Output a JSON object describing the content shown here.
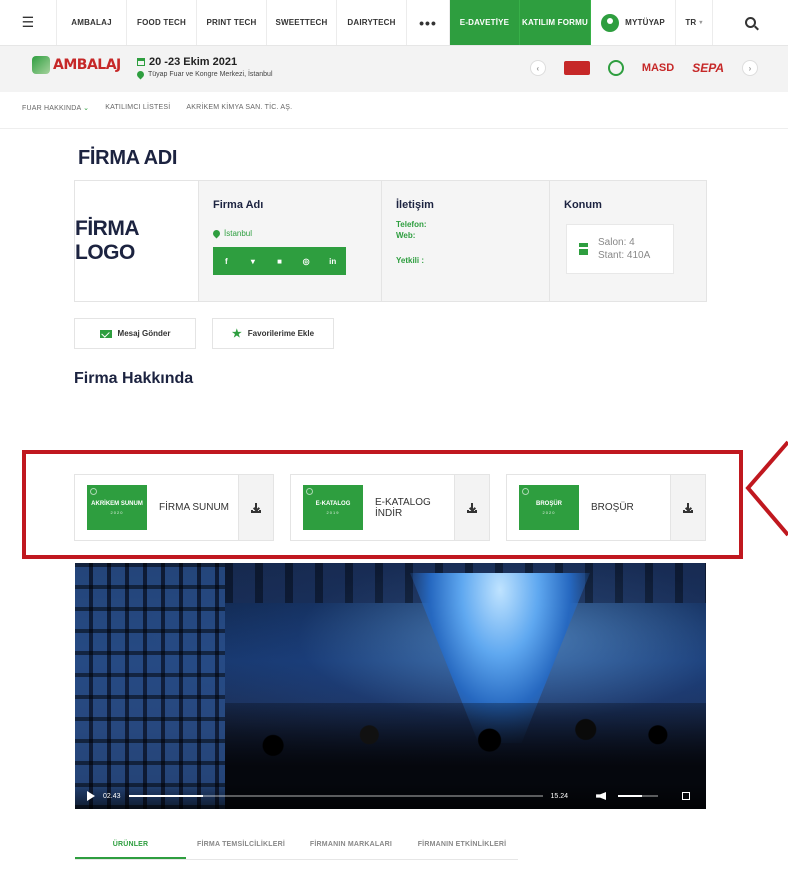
{
  "nav": {
    "menu_icon": "hamburger-icon",
    "items": [
      "AMBALAJ",
      "FOOD TECH",
      "PRINT TECH",
      "SWEETTECH",
      "DAIRYTECH"
    ],
    "more": "•••",
    "e_invite": "E-DAVETİYE",
    "participation_form": "KATILIM FORMU",
    "my_account": "MYTÜYAP",
    "language": "TR",
    "search_icon": "search-icon",
    "accent": "#2e9e3f"
  },
  "event": {
    "logo_text": "AMBALAJ",
    "date": "20 -23 Ekim 2021",
    "venue": "Tüyap Fuar ve Kongre Merkezi, İstanbul"
  },
  "sponsors": [
    "MASD",
    "SEPA"
  ],
  "breadcrumb": [
    "FUAR HAKKINDA",
    "KATILIMCI LİSTESİ",
    "AKRİKEM KİMYA SAN. TİC. AŞ."
  ],
  "page_title": "FİRMA ADI",
  "company": {
    "logo_placeholder": "FİRMA LOGO",
    "name_heading": "Firma Adı",
    "city": "İstanbul",
    "social": [
      "f",
      "t",
      "y",
      "ig",
      "in"
    ],
    "contact_heading": "İletişim",
    "phone_label": "Telefon:",
    "web_label": "Web:",
    "manager_label": "Yetkili :",
    "location_heading": "Konum",
    "hall": "Salon: 4",
    "stand": "Stant: 410A"
  },
  "actions": {
    "send_message": "Mesaj Gönder",
    "add_favorite": "Favorilerime Ekle"
  },
  "about_title": "Firma Hakkında",
  "documents": [
    {
      "thumb_title": "AKRİKEM SUNUM",
      "thumb_year": "2020",
      "label": "FİRMA SUNUM"
    },
    {
      "thumb_title": "E-KATALOG",
      "thumb_year": "2019",
      "label": "E-KATALOG İNDİR"
    },
    {
      "thumb_title": "BROŞÜR",
      "thumb_year": "2020",
      "label": "BROŞÜR"
    }
  ],
  "highlight_color": "#c0181f",
  "video": {
    "current_time": "02.43",
    "duration": "15.24",
    "progress": 0.18,
    "volume": 0.6
  },
  "tabs": [
    "ÜRÜNLER",
    "FİRMA TEMSİLCİLİKLERİ",
    "FİRMANIN MARKALARI",
    "FİRMANIN ETKİNLİKLERİ"
  ],
  "active_tab": "ÜRÜNLER"
}
